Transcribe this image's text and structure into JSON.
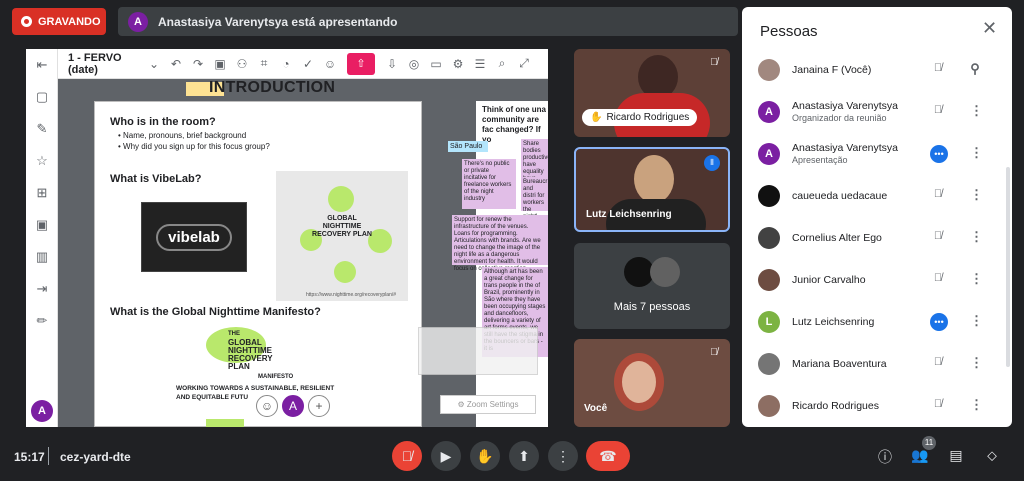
{
  "recording": {
    "label": "GRAVANDO"
  },
  "presenting": {
    "avatar_letter": "A",
    "text": "Anastasiya Varenytsya está apresentando"
  },
  "board": {
    "doc_title": "1 - FERVO (date)",
    "intro_title": "INTRODUCTION",
    "q1": "Who is in the room?",
    "q1_bullets": [
      "• Name, pronouns, brief background",
      "• Why did you sign up for this focus group?"
    ],
    "q2": "What is VibeLab?",
    "vibelab_logo": "vibelab",
    "q3": "What is the Global Nighttime Manifesto?",
    "recovery_small": "GLOBAL NIGHTTIME RECOVERY PLAN",
    "recovery_url": "https://www.nighttime.org/recoveryplan/#",
    "plan_the": "THE",
    "plan_lines": [
      "GLOBAL",
      "NIGHTTIME",
      "RECOVERY",
      "PLAN"
    ],
    "plan_manifesto": "MANIFESTO",
    "plan_sub1": "WORKING TOWARDS A SUSTAINABLE, RESILIENT",
    "plan_sub2": "AND EQUITABLE FUTU",
    "side_question": "Think of one una community are fac changed? If yo",
    "sao_paulo": "São Paulo",
    "sticky1": "There's no public or private incitative for freelance workers of the night industry",
    "sticky2": "Support for renew the infrastructure of the venues. Loans for programming. Articulations with brands. Are we need to change the image of the night life as a dangerous environment for health. It would focus on collective reaction.",
    "sticky3": "Although art has been a great change for trans people in the of Brazil, prominently in São where they have been occupying stages and dancefloors, delivering a variety of art forms events, we still have the stigma in the bouncers or bars - it is",
    "sticky_top": "Share bodies productive have equality have more fr",
    "sticky_mid": "Bureaucr and distri for workers the nightl",
    "zoom_settings": "Zoom Settings",
    "presenter_letter": "A"
  },
  "tiles": [
    {
      "name": "Ricardo Rodrigues"
    },
    {
      "name": "Lutz Leichsenring"
    },
    {
      "name": "Mais 7 pessoas"
    },
    {
      "name": "Você"
    }
  ],
  "people": {
    "title": "Pessoas",
    "list": [
      {
        "name": "Janaina F (Você)",
        "sub": "",
        "letter": "",
        "color": "#a1887f"
      },
      {
        "name": "Anastasiya Varenytsya",
        "sub": "Organizador da reunião",
        "letter": "A",
        "color": "#7b1fa2"
      },
      {
        "name": "Anastasiya Varenytsya",
        "sub": "Apresentação",
        "letter": "A",
        "color": "#7b1fa2"
      },
      {
        "name": "caueueda uedacaue",
        "sub": "",
        "letter": "",
        "color": "#111111"
      },
      {
        "name": "Cornelius Alter Ego",
        "sub": "",
        "letter": "",
        "color": "#424242"
      },
      {
        "name": "Junior Carvalho",
        "sub": "",
        "letter": "",
        "color": "#6d4c41"
      },
      {
        "name": "Lutz Leichsenring",
        "sub": "",
        "letter": "L",
        "color": "#7cb342"
      },
      {
        "name": "Mariana Boaventura",
        "sub": "",
        "letter": "",
        "color": "#757575"
      },
      {
        "name": "Ricardo Rodrigues",
        "sub": "",
        "letter": "",
        "color": "#8d6e63"
      }
    ]
  },
  "bottom": {
    "time": "15:17",
    "code": "cez-yard-dte",
    "people_count": "11"
  }
}
